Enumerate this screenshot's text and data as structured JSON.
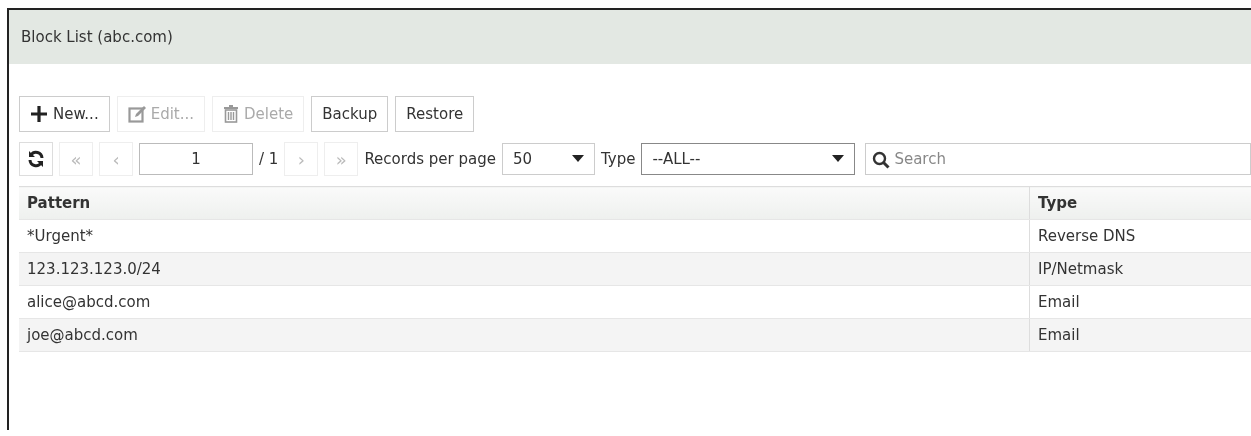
{
  "window": {
    "title": "Block List (abc.com)"
  },
  "toolbar": [
    {
      "kind": "new",
      "label": "New...",
      "disabled": false
    },
    {
      "kind": "edit",
      "label": "Edit...",
      "disabled": true
    },
    {
      "kind": "delete",
      "label": "Delete",
      "disabled": true
    },
    {
      "kind": "plain",
      "label": "Backup",
      "disabled": false
    },
    {
      "kind": "plain",
      "label": "Restore",
      "disabled": false
    }
  ],
  "pager": {
    "first": {
      "label": "«",
      "disabled": true
    },
    "prev": {
      "label": "‹",
      "disabled": true
    },
    "page": "1",
    "total": "/ 1",
    "next": {
      "label": "›",
      "disabled": true
    },
    "last": {
      "label": "»",
      "disabled": true
    },
    "per_page_label": "Records per page",
    "per_page": "50",
    "type_label": "Type",
    "type": "--ALL--",
    "search": {
      "placeholder": "Search"
    }
  },
  "table": {
    "columns": [
      "Pattern",
      "Type"
    ],
    "rows": [
      [
        "*Urgent*",
        "Reverse DNS"
      ],
      [
        "123.123.123.0/24",
        "IP/Netmask"
      ],
      [
        "alice@abcd.com",
        "Email"
      ],
      [
        "joe@abcd.com",
        "Email"
      ]
    ]
  }
}
